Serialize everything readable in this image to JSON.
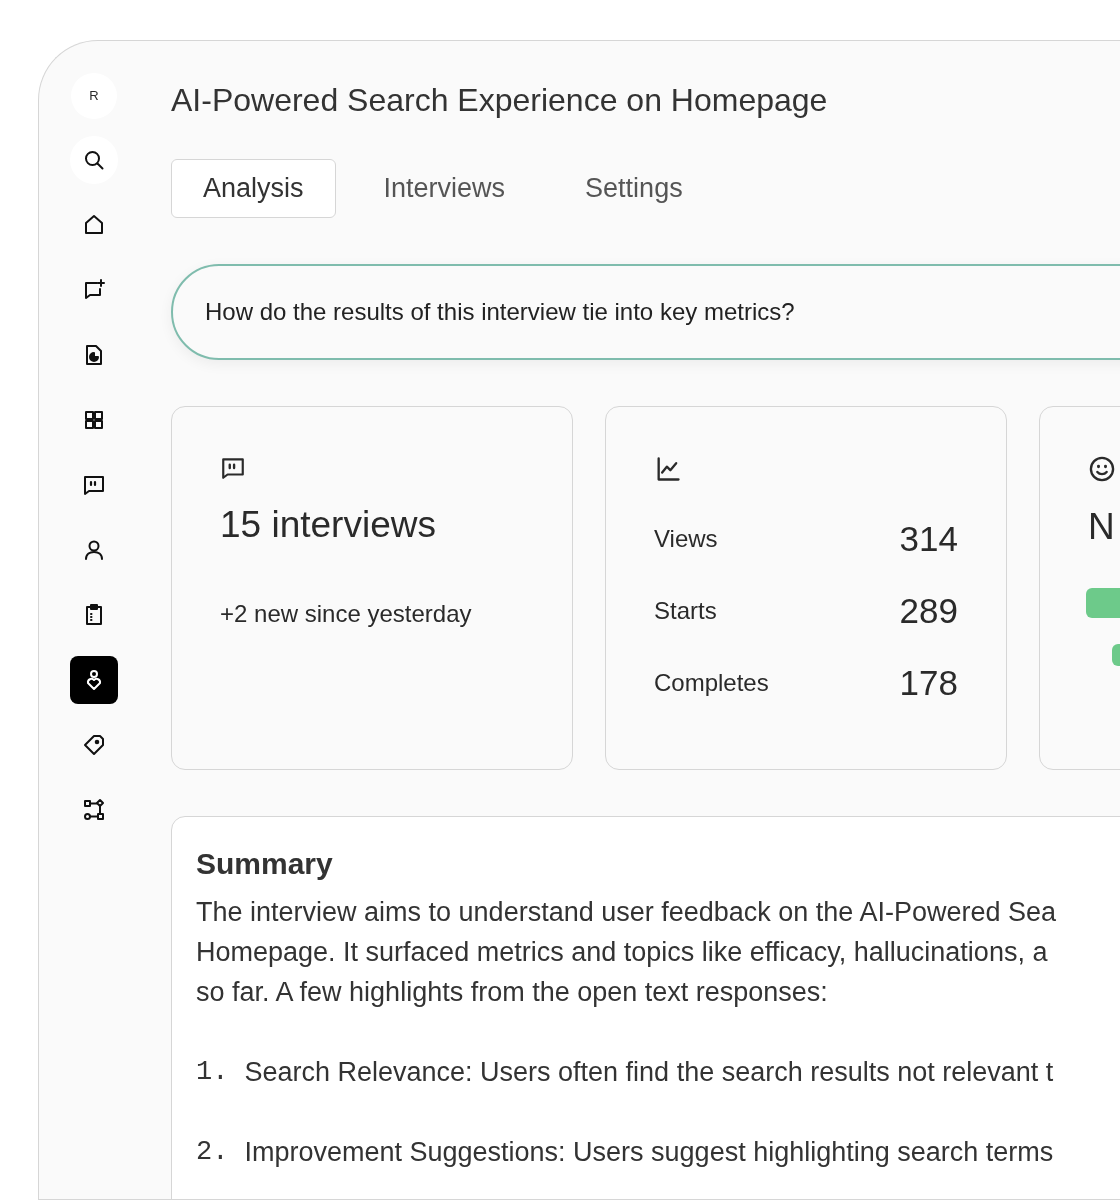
{
  "sidebar": {
    "avatar": "R",
    "items": [
      {
        "selected": false
      },
      {
        "selected": false
      },
      {
        "selected": false
      },
      {
        "selected": false
      },
      {
        "selected": false
      },
      {
        "selected": false
      },
      {
        "selected": false
      },
      {
        "selected": false
      },
      {
        "selected": true
      },
      {
        "selected": false
      },
      {
        "selected": false
      }
    ]
  },
  "title": "AI-Powered Search Experience on Homepage",
  "tabs": [
    {
      "label": "Analysis",
      "selected": true
    },
    {
      "label": "Interviews",
      "selected": false
    },
    {
      "label": "Settings",
      "selected": false
    }
  ],
  "question": {
    "value": "How do the results of this interview tie into key metrics?"
  },
  "cards": [
    {
      "kind": "count",
      "headline": "15 interviews",
      "note": "+2 new since yesterday"
    },
    {
      "kind": "metrics",
      "rows": [
        {
          "label": "Views",
          "value": "314"
        },
        {
          "label": "Starts",
          "value": "289"
        },
        {
          "label": "Completes",
          "value": "178"
        }
      ]
    },
    {
      "kind": "sentiment",
      "headline": "N"
    }
  ],
  "summary": {
    "heading": "Summary",
    "lines": [
      "The interview aims to understand user feedback on the AI-Powered Sea",
      "Homepage. It surfaced metrics and topics like efficacy, hallucinations, a",
      "so far. A few highlights from the open text responses:"
    ],
    "items": [
      {
        "number": "1.",
        "text": "Search Relevance: Users often find the search results not relevant t"
      },
      {
        "number": "2.",
        "text": "Improvement Suggestions: Users suggest highlighting search terms"
      }
    ]
  }
}
